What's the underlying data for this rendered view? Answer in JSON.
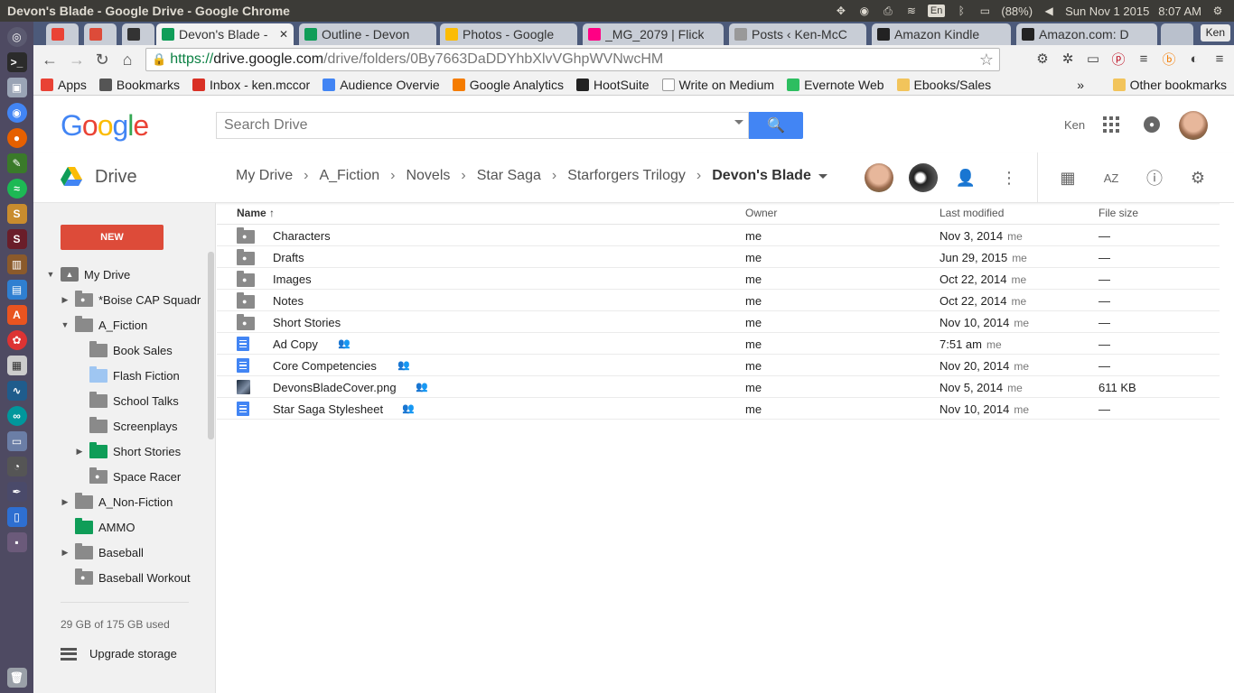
{
  "window": {
    "title": "Devon's Blade - Google Drive - Google Chrome",
    "battery": "(88%)",
    "datetime": "Sun Nov 1 2015",
    "time": "8:07 AM",
    "user": "Ken",
    "lang": "En"
  },
  "tabs": [
    {
      "label": "",
      "color": "#ea4335"
    },
    {
      "label": "",
      "color": "#dd4b39"
    },
    {
      "label": "",
      "color": "#333333"
    },
    {
      "label": "Devon's Blade -",
      "color": "#0f9d58",
      "active": true
    },
    {
      "label": "Outline - Devon",
      "color": "#0f9d58"
    },
    {
      "label": "Photos - Google",
      "color": "#fbbc05"
    },
    {
      "label": "_MG_2079 | Flick",
      "color": "#ff0084"
    },
    {
      "label": "Posts ‹ Ken-McC",
      "color": "#999999"
    },
    {
      "label": "Amazon Kindle",
      "color": "#222222"
    },
    {
      "label": "Amazon.com: D",
      "color": "#222222"
    }
  ],
  "profile_chip": "Ken",
  "omnibox": {
    "https": "https://",
    "host": "drive.google.com",
    "path": "/drive/folders/0By7663DaDDYhbXlvVGhpWVNwcHM"
  },
  "bookmarks": [
    {
      "label": "Apps",
      "color": "#e94235"
    },
    {
      "label": "Bookmarks",
      "color": "#555555"
    },
    {
      "label": "Inbox - ken.mccor",
      "color": "#d93025"
    },
    {
      "label": "Audience Overvie",
      "color": "#4285f4"
    },
    {
      "label": "Google Analytics",
      "color": "#f57c00"
    },
    {
      "label": "HootSuite",
      "color": "#222222"
    },
    {
      "label": "Write on Medium",
      "color": "#ffffff"
    },
    {
      "label": "Evernote Web",
      "color": "#2dbe60"
    },
    {
      "label": "Ebooks/Sales",
      "color": "#f2c45b"
    }
  ],
  "bookmarks_more": "»",
  "bookmarks_other": "Other bookmarks",
  "drive_header": {
    "search_placeholder": "Search Drive",
    "account_name": "Ken"
  },
  "toolbar": {
    "app_label": "Drive",
    "breadcrumbs": [
      "My Drive",
      "A_Fiction",
      "Novels",
      "Star Saga",
      "Starforgers Trilogy"
    ],
    "current": "Devon's Blade",
    "sort_label": "AZ"
  },
  "sidebar": {
    "new_label": "NEW",
    "tree": [
      {
        "label": "My Drive",
        "indent": 0,
        "arrow": "▼",
        "type": "mydrive"
      },
      {
        "label": "*Boise CAP Squadr",
        "indent": 1,
        "arrow": "▶",
        "type": "shared"
      },
      {
        "label": "A_Fiction",
        "indent": 1,
        "arrow": "▼",
        "type": "gray"
      },
      {
        "label": "Book Sales",
        "indent": 2,
        "arrow": "",
        "type": "gray"
      },
      {
        "label": "Flash Fiction",
        "indent": 2,
        "arrow": "",
        "type": "blue"
      },
      {
        "label": "School Talks",
        "indent": 2,
        "arrow": "",
        "type": "gray"
      },
      {
        "label": "Screenplays",
        "indent": 2,
        "arrow": "",
        "type": "gray"
      },
      {
        "label": "Short Stories",
        "indent": 2,
        "arrow": "▶",
        "type": "green"
      },
      {
        "label": "Space Racer",
        "indent": 2,
        "arrow": "",
        "type": "shared"
      },
      {
        "label": "A_Non-Fiction",
        "indent": 1,
        "arrow": "▶",
        "type": "gray"
      },
      {
        "label": "AMMO",
        "indent": 1,
        "arrow": "",
        "type": "green"
      },
      {
        "label": "Baseball",
        "indent": 1,
        "arrow": "▶",
        "type": "gray"
      },
      {
        "label": "Baseball Workout",
        "indent": 1,
        "arrow": "",
        "type": "shared"
      }
    ],
    "storage": "29 GB of 175 GB used",
    "upgrade": "Upgrade storage"
  },
  "filelist": {
    "headers": {
      "name": "Name ↑",
      "owner": "Owner",
      "modified": "Last modified",
      "size": "File size"
    },
    "rows": [
      {
        "name": "Characters",
        "kind": "folder-shared",
        "shared": false,
        "owner": "me",
        "modified": "Nov 3, 2014",
        "by": "me",
        "size": "—"
      },
      {
        "name": "Drafts",
        "kind": "folder-shared",
        "shared": false,
        "owner": "me",
        "modified": "Jun 29, 2015",
        "by": "me",
        "size": "—"
      },
      {
        "name": "Images",
        "kind": "folder-shared",
        "shared": false,
        "owner": "me",
        "modified": "Oct 22, 2014",
        "by": "me",
        "size": "—"
      },
      {
        "name": "Notes",
        "kind": "folder-shared",
        "shared": false,
        "owner": "me",
        "modified": "Oct 22, 2014",
        "by": "me",
        "size": "—"
      },
      {
        "name": "Short Stories",
        "kind": "folder-shared",
        "shared": false,
        "owner": "me",
        "modified": "Nov 10, 2014",
        "by": "me",
        "size": "—"
      },
      {
        "name": "Ad Copy",
        "kind": "doc",
        "shared": true,
        "owner": "me",
        "modified": "7:51 am",
        "by": "me",
        "size": "—"
      },
      {
        "name": "Core Competencies",
        "kind": "doc",
        "shared": true,
        "owner": "me",
        "modified": "Nov 20, 2014",
        "by": "me",
        "size": "—"
      },
      {
        "name": "DevonsBladeCover.png",
        "kind": "image",
        "shared": true,
        "owner": "me",
        "modified": "Nov 5, 2014",
        "by": "me",
        "size": "611 KB"
      },
      {
        "name": "Star Saga Stylesheet",
        "kind": "doc",
        "shared": true,
        "owner": "me",
        "modified": "Nov 10, 2014",
        "by": "me",
        "size": "—"
      }
    ]
  },
  "colors": {
    "new_button": "#dd4b39",
    "search_button": "#4285f4",
    "doc_icon": "#4285f4",
    "green_folder": "#0f9d58"
  }
}
